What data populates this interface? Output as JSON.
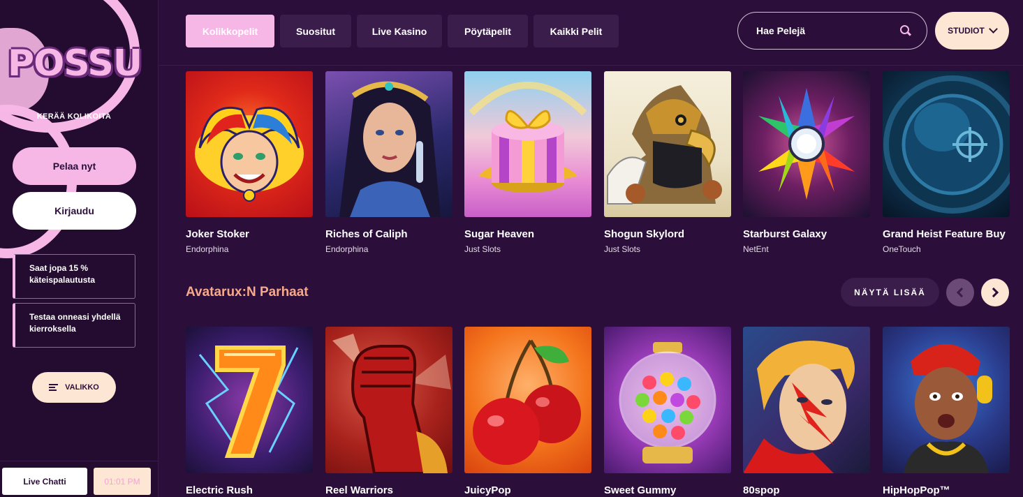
{
  "sidebar": {
    "logo": "POSSU",
    "tagline": "KERÄÄ KOLIKOITA",
    "play_label": "Pelaa nyt",
    "login_label": "Kirjaudu",
    "promos": [
      {
        "text": "Saat jopa 15 % käteispalautusta"
      },
      {
        "text": "Testaa onneasi yhdellä kierroksella"
      }
    ],
    "menu_label": "VALIKKO",
    "chat_label": "Live Chatti",
    "clock": "01:01 PM"
  },
  "topbar": {
    "tabs": [
      {
        "label": "Kolikkopelit",
        "active": true
      },
      {
        "label": "Suositut"
      },
      {
        "label": "Live Kasino"
      },
      {
        "label": "Pöytäpelit"
      },
      {
        "label": "Kaikki Pelit"
      }
    ],
    "search_placeholder": "Hae Pelejä",
    "studios_label": "STUDIOT"
  },
  "row1": {
    "games": [
      {
        "title": "Joker Stoker",
        "studio": "Endorphina"
      },
      {
        "title": "Riches of Caliph",
        "studio": "Endorphina"
      },
      {
        "title": "Sugar Heaven",
        "studio": "Just Slots"
      },
      {
        "title": "Shogun Skylord",
        "studio": "Just Slots"
      },
      {
        "title": "Starburst Galaxy",
        "studio": "NetEnt"
      },
      {
        "title": "Grand Heist Feature Buy",
        "studio": "OneTouch"
      }
    ]
  },
  "section2": {
    "title": "Avatarux:N Parhaat",
    "show_more": "NÄYTÄ LISÄÄ",
    "games": [
      {
        "title": "Electric Rush"
      },
      {
        "title": "Reel Warriors"
      },
      {
        "title": "JuicyPop"
      },
      {
        "title": "Sweet Gummy"
      },
      {
        "title": "80spop"
      },
      {
        "title": "HipHopPop™"
      }
    ]
  },
  "colors": {
    "background": "#2b0f3a",
    "sidebar": "#240b30",
    "accent_pink": "#f7b7e6",
    "cream": "#fde6d3",
    "section_title": "#f7a98b"
  }
}
